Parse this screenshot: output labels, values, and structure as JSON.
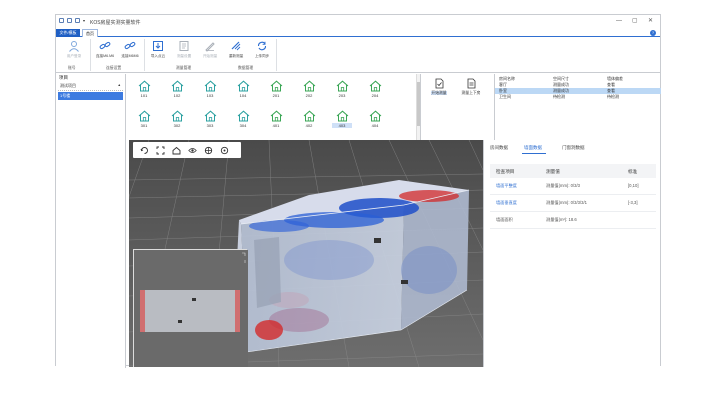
{
  "window": {
    "title": "KOS房屋实测实量软件",
    "controls": {
      "minimize": "—",
      "maximize": "▢",
      "close": "✕"
    }
  },
  "menu": {
    "app_tab": "文件/模板",
    "home_tab": "首页",
    "help": "?"
  },
  "ribbon": {
    "buttons": [
      {
        "label": "用户登录",
        "icon": "user-icon",
        "disabled": true
      },
      {
        "label": "连接M6.M6",
        "icon": "link-icon",
        "disabled": false
      },
      {
        "label": "连接M6M6",
        "icon": "link-icon",
        "disabled": false
      },
      {
        "label": "导入点云",
        "icon": "import-icon",
        "disabled": false
      },
      {
        "label": "测量设置",
        "icon": "settings-icon",
        "disabled": true
      },
      {
        "label": "开始测量",
        "icon": "measure-icon",
        "disabled": true
      },
      {
        "label": "重新测量",
        "icon": "remeasure-icon",
        "disabled": false
      },
      {
        "label": "上传同步",
        "icon": "sync-icon",
        "disabled": false
      }
    ],
    "groups": [
      "账号",
      "连接设置",
      "测量管理",
      "数据管理"
    ]
  },
  "tree": {
    "header": "项目",
    "project": "测试项目",
    "building": "1号楼"
  },
  "rooms": [
    {
      "label": "101",
      "selected": false
    },
    {
      "label": "102",
      "selected": false
    },
    {
      "label": "103",
      "selected": false
    },
    {
      "label": "104",
      "selected": false
    },
    {
      "label": "201",
      "selected": false
    },
    {
      "label": "202",
      "selected": false
    },
    {
      "label": "203",
      "selected": false
    },
    {
      "label": "204",
      "selected": false
    },
    {
      "label": "301",
      "selected": false
    },
    {
      "label": "302",
      "selected": false
    },
    {
      "label": "303",
      "selected": false
    },
    {
      "label": "304",
      "selected": false
    },
    {
      "label": "401",
      "selected": false
    },
    {
      "label": "402",
      "selected": false
    },
    {
      "label": "403",
      "selected": true
    },
    {
      "label": "404",
      "selected": false
    }
  ],
  "measure_tools": [
    {
      "label": "开始测量",
      "selected": true
    },
    {
      "label": "测量上下房",
      "selected": false
    }
  ],
  "measure_list": [
    {
      "c1": "房间名称",
      "c2": "空间尺寸",
      "c3": "墙体偏差",
      "selected": false
    },
    {
      "c1": "客厅",
      "c2": "测量成功",
      "c3": "查看",
      "selected": false
    },
    {
      "c1": "卧室",
      "c2": "测量成功",
      "c3": "查看",
      "selected": true
    },
    {
      "c1": "卫生间",
      "c2": "待检测",
      "c3": "待检测",
      "selected": false
    }
  ],
  "viewport": {
    "tools": [
      "rotate-icon",
      "fit-icon",
      "home-view-icon",
      "eye-icon",
      "target-icon",
      "crosshair-icon"
    ]
  },
  "right_panel": {
    "tabs": [
      "房间数据",
      "墙面数据",
      "门窗洞数据"
    ],
    "active_tab": 1,
    "columns": [
      "检查项目",
      "测量值",
      "标准"
    ],
    "rows": [
      {
        "item": "墙面平整度",
        "value": "测量值(mm): 0/3/3",
        "standard": "[0,10]",
        "link": true
      },
      {
        "item": "墙面垂直度",
        "value": "测量值(mm): 0/3/3/3/1",
        "standard": "[-3,3]",
        "link": true
      },
      {
        "item": "墙面面积",
        "value": "测量值(m²): 18.6",
        "standard": "",
        "link": false
      }
    ]
  },
  "colors": {
    "accent": "#2f6fd1",
    "viewport_bg": "#5c5c5c",
    "heat_high": "#d32a2a",
    "heat_low": "#1e4fc9"
  }
}
